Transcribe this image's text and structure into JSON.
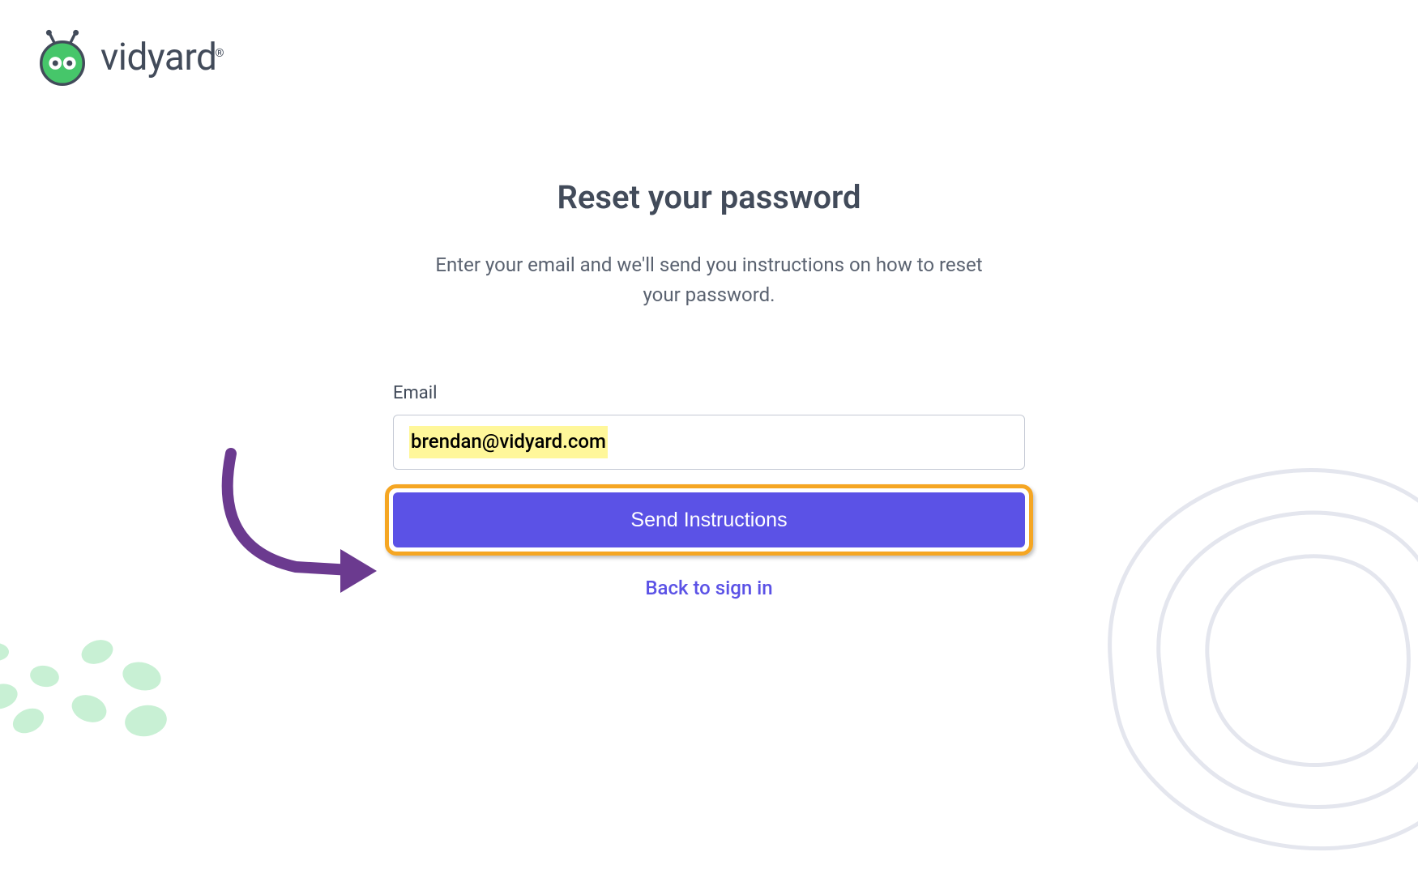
{
  "brand": {
    "name": "vidyard",
    "registered_mark": "®"
  },
  "page": {
    "title": "Reset your password",
    "description": "Enter your email and we'll send you instructions on how to reset your password."
  },
  "form": {
    "email_label": "Email",
    "email_value": "brendan@vidyard.com",
    "submit_label": "Send Instructions",
    "back_link_label": "Back to sign in"
  },
  "colors": {
    "accent": "#5b52e6",
    "highlight_ring": "#f5a623",
    "text_highlight": "#fff79a",
    "brand_green": "#46c66a",
    "brand_dark": "#424b5a",
    "annotation_arrow": "#6b3a8f"
  }
}
